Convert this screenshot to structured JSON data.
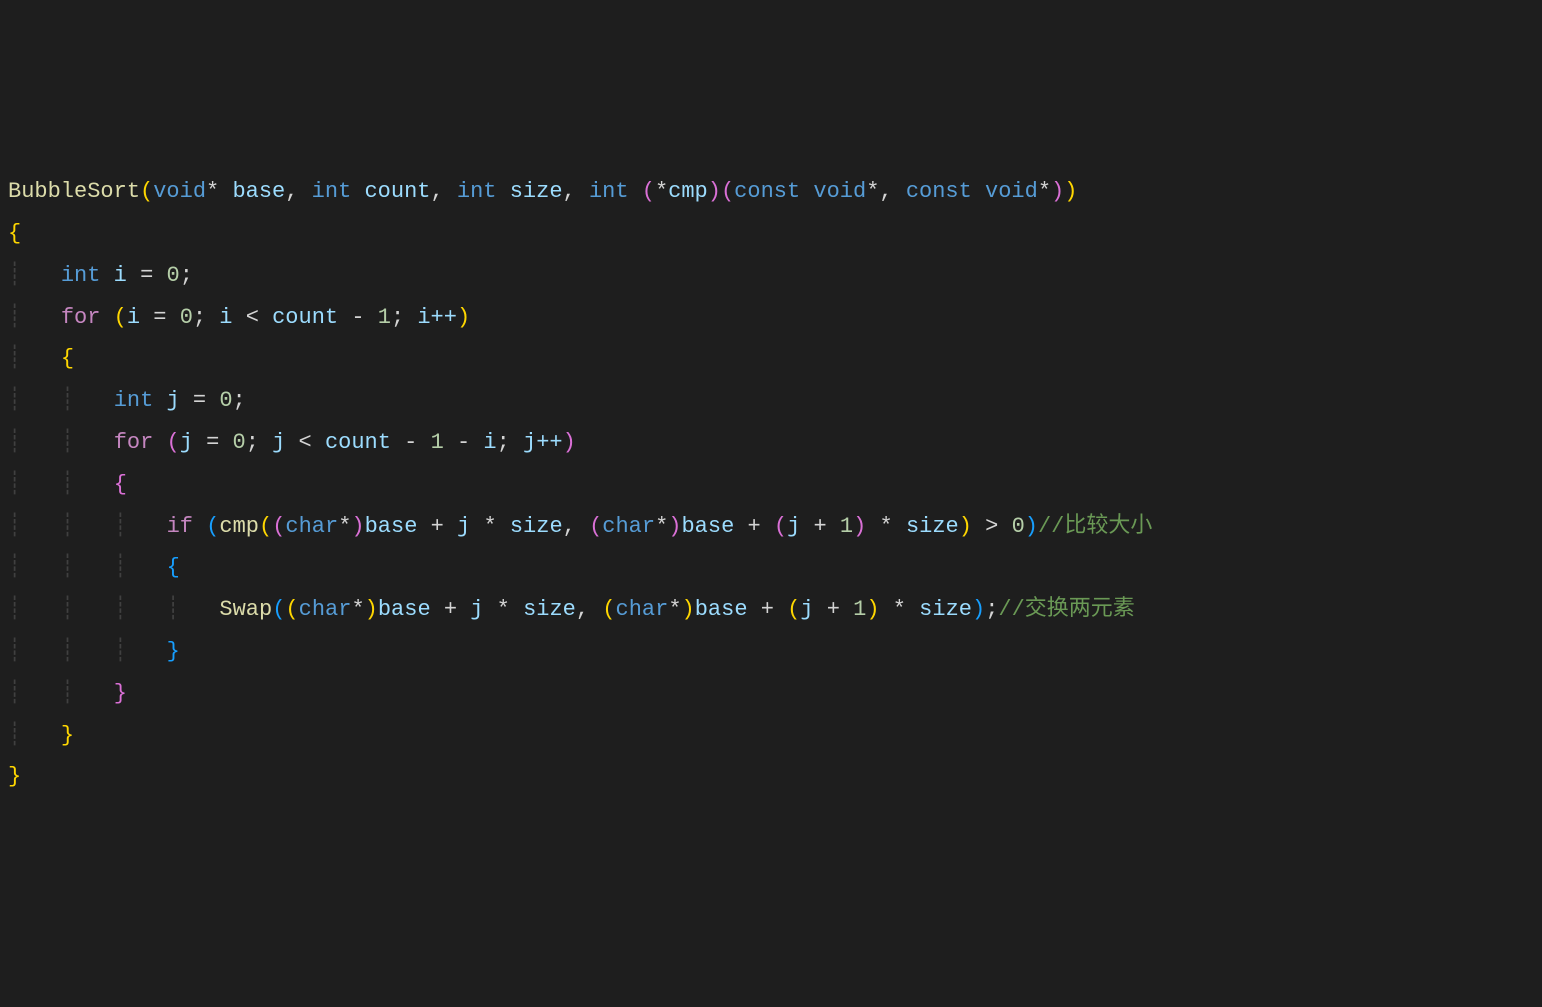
{
  "code": {
    "function_name": "BubbleSort",
    "params": {
      "p1_type": "void",
      "p1_ptr": "*",
      "p1_name": "base",
      "p2_type": "int",
      "p2_name": "count",
      "p3_type": "int",
      "p3_name": "size",
      "p4_type": "int",
      "p4_fnptr_star": "*",
      "p4_fnptr_name": "cmp",
      "p4a_kw": "const",
      "p4a_type": "void",
      "p4a_ptr": "*",
      "p4b_kw": "const",
      "p4b_type": "void",
      "p4b_ptr": "*"
    },
    "decl_i_type": "int",
    "decl_i_name": "i",
    "decl_i_val": "0",
    "for1_kw": "for",
    "for1_init_var": "i",
    "for1_init_val": "0",
    "for1_cond_var": "i",
    "for1_cond_rhs": "count",
    "for1_cond_minus": "1",
    "for1_inc": "i++",
    "decl_j_type": "int",
    "decl_j_name": "j",
    "decl_j_val": "0",
    "for2_kw": "for",
    "for2_init_var": "j",
    "for2_init_val": "0",
    "for2_cond_var": "j",
    "for2_cond_rhs": "count",
    "for2_cond_minus1": "1",
    "for2_cond_minus2": "i",
    "for2_inc": "j++",
    "if_kw": "if",
    "cmp_call": "cmp",
    "cast_type": "char",
    "cast_ptr": "*",
    "base_ref": "base",
    "j_ref": "j",
    "size_ref": "size",
    "one": "1",
    "zero_cmp": "0",
    "comment1": "//比较大小",
    "swap_call": "Swap",
    "comment2": "//交换两元素",
    "brace_open": "{",
    "brace_close": "}",
    "paren_open": "(",
    "paren_close": ")",
    "semicolon": ";",
    "comma": ",",
    "space": " ",
    "eq": "=",
    "lt": "<",
    "gt": ">",
    "plus": "+",
    "minus": "-",
    "star": "*"
  }
}
